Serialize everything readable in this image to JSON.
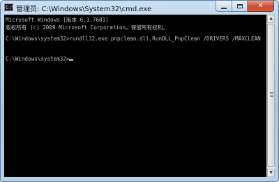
{
  "window": {
    "title": "管理员: C:\\Windows\\System32\\cmd.exe",
    "icon": "cmd-icon"
  },
  "controls": {
    "minimize_icon": "minimize-icon",
    "maximize_icon": "maximize-icon",
    "close_icon": "close-icon",
    "close_glyph": "✕"
  },
  "console": {
    "lines": [
      "Microsoft Windows [版本 6.1.7601]",
      "版权所有 (c) 2009 Microsoft Corporation。保留所有权利。",
      "",
      "C:\\Windows\\system32>rundll32.exe pnpclean.dll,RunDLL_PnpClean /DRIVERS /MAXCLEAN",
      "",
      "C:\\Windows\\system32>"
    ],
    "background": "#000000",
    "foreground": "#c0c0c0"
  },
  "scrollbar": {
    "up_glyph": "▲",
    "down_glyph": "▼"
  }
}
